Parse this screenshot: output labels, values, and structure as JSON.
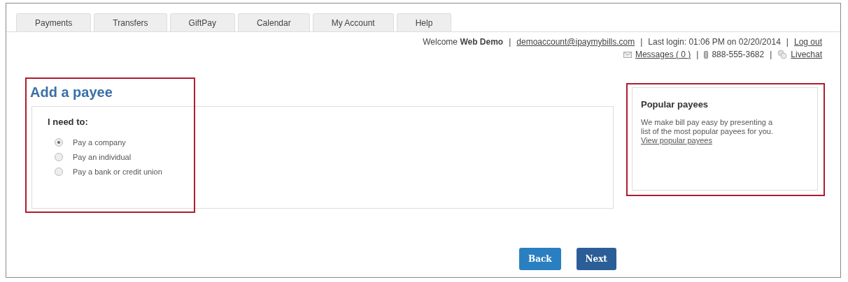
{
  "tabs": [
    {
      "label": "Payments"
    },
    {
      "label": "Transfers"
    },
    {
      "label": "GiftPay"
    },
    {
      "label": "Calendar"
    },
    {
      "label": "My Account"
    },
    {
      "label": "Help"
    }
  ],
  "header_line_1": [
    {
      "kind": "text",
      "text": "Welcome **Web Demo**"
    },
    {
      "kind": "sep",
      "text": "|"
    },
    {
      "kind": "link",
      "text": "demoaccount@ipaymybills.com"
    },
    {
      "kind": "sep",
      "text": "|"
    },
    {
      "kind": "text",
      "text": "Last login: 01:06 PM on 02/20/2014"
    },
    {
      "kind": "sep",
      "text": "|"
    },
    {
      "kind": "link",
      "text": "Log out"
    }
  ],
  "header_line_2": [
    {
      "kind": "link",
      "text": "Messages ( 0 )"
    },
    {
      "kind": "sep",
      "text": "|"
    },
    {
      "kind": "text",
      "text": "888-555-3682"
    },
    {
      "kind": "sep",
      "text": "|"
    },
    {
      "kind": "link",
      "text": "Livechat"
    }
  ],
  "page_title": "Add a payee",
  "form": {
    "heading": "I need to:",
    "options": [
      {
        "label": "Pay a company",
        "selected": true
      },
      {
        "label": "Pay an individual",
        "selected": false
      },
      {
        "label": "Pay a bank or credit union",
        "selected": false
      }
    ]
  },
  "popular": {
    "title": "Popular payees",
    "text": "We make bill pay easy by presenting a list of the most popular payees for you.",
    "link": "View popular payees"
  },
  "buttons": [
    {
      "label": "Back",
      "kind": "secondary"
    },
    {
      "label": "Next",
      "kind": "primary"
    }
  ]
}
